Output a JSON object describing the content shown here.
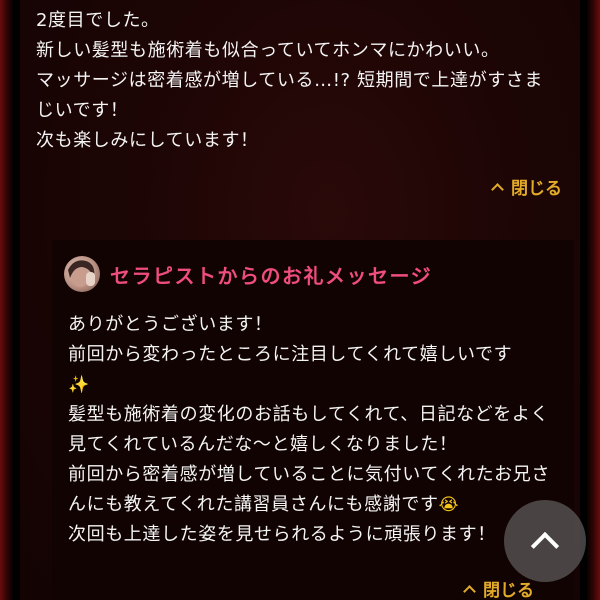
{
  "review": {
    "lines": [
      "2度目でした。",
      "新しい髪型も施術着も似合っていてホンマにかわいい。",
      "マッサージは密着感が増している…!? 短期間で上達がすさま",
      "じいです！",
      "次も楽しみにしています！"
    ],
    "collapse_label": "閉じる"
  },
  "reply": {
    "title": "セラピストからのお礼メッセージ",
    "line1": "ありがとうございます！",
    "line2": "前回から変わったところに注目してくれて嬉しいです",
    "line3": "髪型も施術着の変化のお話もしてくれて、日記などをよく見てくれているんだな〜と嬉しくなりました！",
    "line4": "前回から密着感が増していることに気付いてくれたお兄さんにも教えてくれた講習員さんにも感謝です",
    "line5": "次回も上達した姿を見せられるように頑張ります！",
    "sparkle_emoji": "✨",
    "crying_emoji": "😭",
    "collapse_label": "閉じる"
  },
  "colors": {
    "accent_gold": "#e3ab2a",
    "title_pink": "#ef4d7c",
    "background": "#1d0505"
  },
  "icons": {
    "collapse": "chevron-up-icon",
    "scroll_top": "chevron-up-icon",
    "avatar": "therapist-avatar"
  }
}
